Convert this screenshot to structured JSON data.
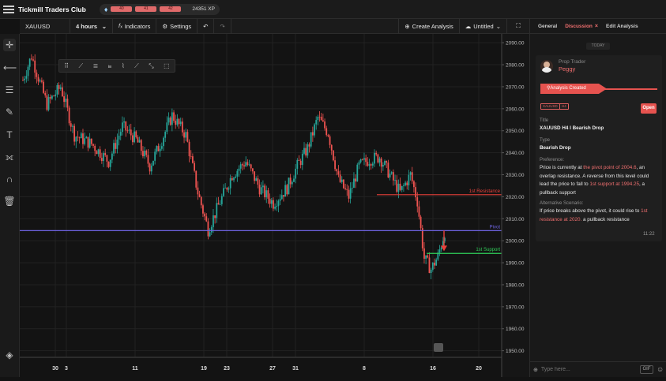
{
  "app": {
    "title": "Tickmill Traders Club",
    "levels": [
      "40",
      "41",
      "42"
    ],
    "xp": "24351 XP"
  },
  "toolbar": {
    "symbol": "XAUUSD",
    "timeframe": "4 hours",
    "indicators_label": "Indicators",
    "settings_label": "Settings",
    "create_analysis_label": "Create Analysis",
    "title_dropdown": "Untitled"
  },
  "panel": {
    "tabs": [
      "General",
      "Discussion",
      "Edit Analysis"
    ],
    "active_tab": "Discussion",
    "today_label": "TODAY",
    "role": "Prop Trader",
    "author": "Peggy",
    "created_label": "Analysis Created",
    "chips": [
      "XAUUSD",
      "H4"
    ],
    "open_label": "Open",
    "title_label": "Title",
    "title_value": "XAUUSD H4 I Bearish Drop",
    "type_label": "Type",
    "type_value": "Bearish Drop",
    "preference_label": "Preference:",
    "preference_1": "Price is currently at ",
    "preference_hl1": "the pivot point of 2004.6",
    "preference_2": ", an overlap resistance. A reverse from this level could lead the price to fall to ",
    "preference_hl2": "1st support at 1994.25",
    "preference_3": ", a pullback support",
    "alt_label": "Alternative Scenario:",
    "alt_1": "If price breaks above the pivot, it could rise to ",
    "alt_hl": "1st resistance at 2020.",
    "alt_2": " a pullback resistance",
    "time": "11:22",
    "composer_placeholder": "Type here...",
    "gif_label": "GIF"
  },
  "chart_data": {
    "type": "candlestick",
    "symbol": "XAUUSD",
    "y_ticks": [
      "2090.00",
      "2080.00",
      "2070.00",
      "2060.00",
      "2050.00",
      "2040.00",
      "2030.00",
      "2020.00",
      "2010.00",
      "2000.00",
      "1990.00",
      "1980.00",
      "1970.00",
      "1960.00",
      "1950.00"
    ],
    "ylim": [
      1947,
      2094
    ],
    "x_ticks": [
      "30",
      "3",
      "11",
      "19",
      "23",
      "27",
      "31",
      "8",
      "16",
      "20"
    ],
    "levels": [
      {
        "name": "1st Resistance",
        "value": 2020.92,
        "label": "2020.92",
        "color": "#e8413b"
      },
      {
        "name": "Pivot",
        "value": 2004.6,
        "label": "2004.60",
        "color": "#6e63e0"
      },
      {
        "name": "1st Support",
        "value": 1994.25,
        "label": "1994.25",
        "color": "#2fd15a"
      }
    ],
    "up_color": "#26a69a",
    "down_color": "#ef5350",
    "trend_anchors": [
      [
        0,
        2073
      ],
      [
        5,
        2084
      ],
      [
        14,
        2062
      ],
      [
        22,
        2070
      ],
      [
        30,
        2048
      ],
      [
        40,
        2044
      ],
      [
        50,
        2036
      ],
      [
        58,
        2052
      ],
      [
        66,
        2046
      ],
      [
        74,
        2034
      ],
      [
        80,
        2044
      ],
      [
        87,
        2057
      ],
      [
        95,
        2048
      ],
      [
        102,
        2022
      ],
      [
        108,
        2005
      ],
      [
        114,
        2016
      ],
      [
        122,
        2030
      ],
      [
        130,
        2036
      ],
      [
        138,
        2024
      ],
      [
        146,
        2017
      ],
      [
        154,
        2024
      ],
      [
        160,
        2034
      ],
      [
        166,
        2042
      ],
      [
        172,
        2056
      ],
      [
        178,
        2049
      ],
      [
        184,
        2028
      ],
      [
        190,
        2020
      ],
      [
        196,
        2034
      ],
      [
        202,
        2037
      ],
      [
        208,
        2038
      ],
      [
        214,
        2030
      ],
      [
        220,
        2022
      ],
      [
        226,
        2030
      ],
      [
        230,
        2018
      ],
      [
        234,
        1992
      ],
      [
        238,
        1987
      ],
      [
        242,
        1993
      ],
      [
        246,
        2004
      ]
    ]
  }
}
